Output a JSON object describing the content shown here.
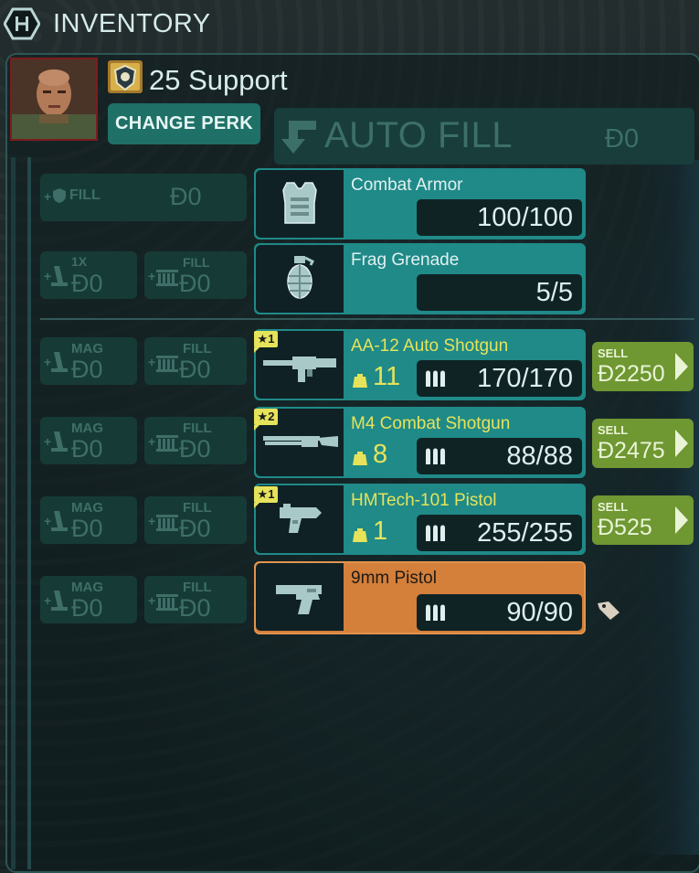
{
  "header": {
    "title": "INVENTORY"
  },
  "profile": {
    "perk_label": "25 Support",
    "change_perk": "CHANGE PERK"
  },
  "autofill": {
    "label": "AUTO FILL",
    "price": "Ɖ0"
  },
  "armor_fill": {
    "label": "FILL",
    "price": "Ɖ0"
  },
  "grenade_fill": {
    "single": {
      "label": "1X",
      "price": "Ɖ0"
    },
    "fill": {
      "label": "FILL",
      "price": "Ɖ0"
    }
  },
  "items": [
    {
      "name": "Combat Armor",
      "value": "100/100"
    },
    {
      "name": "Frag Grenade",
      "value": "5/5"
    }
  ],
  "weapons": [
    {
      "tier": "1",
      "name": "AA-12 Auto Shotgun",
      "weight": "11",
      "ammo": "170/170",
      "mag": "MAG",
      "mag_price": "Ɖ0",
      "fill": "FILL",
      "fill_price": "Ɖ0",
      "sell_label": "SELL",
      "sell_price": "Ɖ2250"
    },
    {
      "tier": "2",
      "name": "M4 Combat Shotgun",
      "weight": "8",
      "ammo": "88/88",
      "mag": "MAG",
      "mag_price": "Ɖ0",
      "fill": "FILL",
      "fill_price": "Ɖ0",
      "sell_label": "SELL",
      "sell_price": "Ɖ2475"
    },
    {
      "tier": "1",
      "name": "HMTech-101 Pistol",
      "weight": "1",
      "ammo": "255/255",
      "mag": "MAG",
      "mag_price": "Ɖ0",
      "fill": "FILL",
      "fill_price": "Ɖ0",
      "sell_label": "SELL",
      "sell_price": "Ɖ525"
    },
    {
      "name": "9mm Pistol",
      "ammo": "90/90",
      "mag": "MAG",
      "mag_price": "Ɖ0",
      "fill": "FILL",
      "fill_price": "Ɖ0"
    }
  ],
  "icons": {
    "logo": "hex-logo-icon",
    "perk": "support-perk-icon",
    "autofill": "autofill-arrow-icon",
    "armor": "armor-icon",
    "grenade": "grenade-icon",
    "shield": "shield-icon",
    "magazine": "magazine-icon",
    "ammo_crate": "ammo-crate-icon",
    "weight": "weight-icon",
    "bullets": "bullets-icon",
    "sell_arrow": "chevron-right-icon",
    "tag": "price-tag-icon"
  },
  "colors": {
    "card_teal": "#1f8a88",
    "card_orange": "#d47f3a",
    "weapon_name": "#e6e35a",
    "sell_green": "#6f9732",
    "change_perk": "#1f7168"
  }
}
